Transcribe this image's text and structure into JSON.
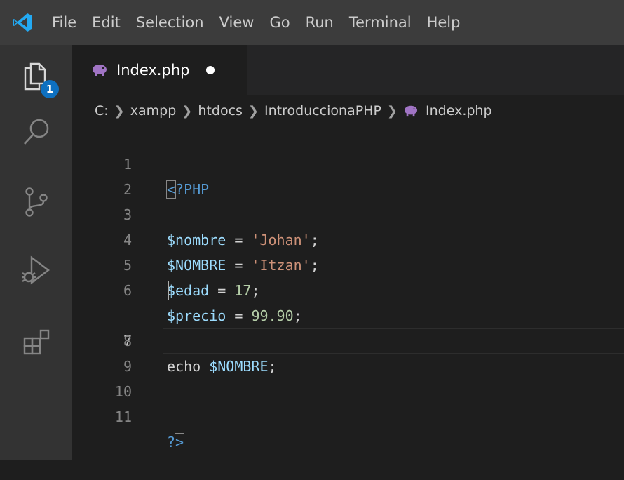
{
  "menu": [
    "File",
    "Edit",
    "Selection",
    "View",
    "Go",
    "Run",
    "Terminal",
    "Help"
  ],
  "activity": {
    "explorer_badge": "1"
  },
  "tab": {
    "label": "Index.php"
  },
  "breadcrumb": [
    "C:",
    "xampp",
    "htdocs",
    "IntroduccionaPHP",
    "Index.php"
  ],
  "editor": {
    "lines": [
      {
        "n": "1",
        "text": "<?PHP"
      },
      {
        "n": "2",
        "text": ""
      },
      {
        "n": "3",
        "text": "$nombre = 'Johan';"
      },
      {
        "n": "4",
        "text": "$NOMBRE = 'Itzan';"
      },
      {
        "n": "5",
        "text": "$edad = 17;"
      },
      {
        "n": "6",
        "text": "$precio = 99.90;"
      },
      {
        "n": "7",
        "text": ""
      },
      {
        "n": "8",
        "text": "echo $NOMBRE;"
      },
      {
        "n": "9",
        "text": ""
      },
      {
        "n": "10",
        "text": ""
      },
      {
        "n": "11",
        "text": "?>"
      }
    ],
    "active_line": "7"
  },
  "colors": {
    "variable": "#9cdcfe",
    "string": "#ce9178",
    "number": "#b5cea8",
    "tag": "#569cd6",
    "accent": "#0e70c0"
  }
}
